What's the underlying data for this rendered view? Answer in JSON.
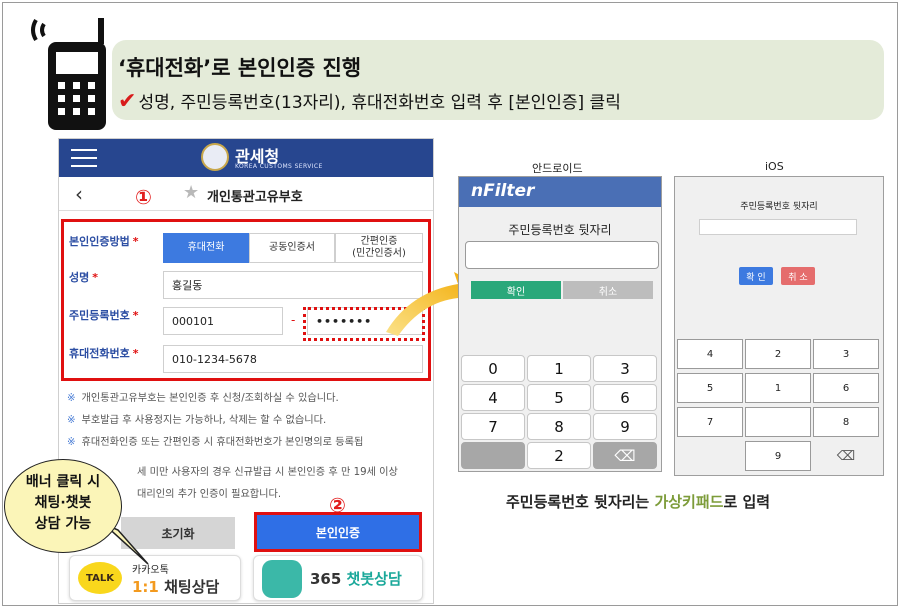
{
  "header": {
    "title": "‘휴대전화’로 본인인증 진행",
    "subtitle": "성명, 주민등록번호(13자리), 휴대전화번호 입력 후 [본인인증] 클릭",
    "check_mark": "✔"
  },
  "form_panel": {
    "org_name": "관세청",
    "org_subtitle": "KOREA CUSTOMS SERVICE",
    "page_title": "개인통관고유부호",
    "step1": "①",
    "step2": "②",
    "auth_method_label": "본인인증방법",
    "tabs": [
      "휴대전화",
      "공동인증서",
      "간편인증\n(민간인증서)"
    ],
    "name_label": "성명",
    "name_value": "홍길동",
    "rrn_label": "주민등록번호",
    "rrn_front": "000101",
    "rrn_dash": "-",
    "rrn_back": "•••••••",
    "phone_label": "휴대전화번호",
    "phone_value": "010-1234-5678",
    "required_mark": "*",
    "note_mark": "※",
    "notes": [
      "개인통관고유부호는 본인인증 후 신청/조회하실 수 있습니다.",
      "부호발급 후 사용정지는 가능하나, 삭제는 할 수 없습니다.",
      "휴대전화인증 또는 간편인증 시 휴대전화번호가 본인명의로 등록됩",
      "세 미만 사용자의 경우 신규발급 시 본인인증 후 만 19세 이상",
      "대리인의 추가 인증이 필요합니다."
    ],
    "reset_button": "초기화",
    "cert_button": "본인인증",
    "kakao_line1": "카카오톡",
    "kakao_line2_a": "1:1",
    "kakao_line2_b": " 채팅상담",
    "kakao_talk": "TALK",
    "bot_text_a": "365 ",
    "bot_text_b": "챗봇상담"
  },
  "callout": {
    "line1": "배너 클릭 시",
    "line2": "채팅·챗봇",
    "line3": "상담 가능"
  },
  "android": {
    "caption": "안드로이드",
    "logo": "nFilter",
    "label": "주민등록번호 뒷자리",
    "ok": "확인",
    "cancel": "취소",
    "keys": [
      "0",
      "1",
      "3",
      "4",
      "5",
      "6",
      "7",
      "8",
      "9",
      "",
      "2",
      "⌫"
    ]
  },
  "ios": {
    "caption": "iOS",
    "label": "주민등록번호 뒷자리",
    "ok": "확 인",
    "cancel": "취 소",
    "keys": [
      "4",
      "2",
      "3",
      "5",
      "1",
      "6",
      "7",
      "",
      "8",
      "",
      "9",
      "⌫"
    ]
  },
  "bottom_caption": {
    "a": "주민등록번호 뒷자리는 ",
    "b": "가상키패드",
    "c": "로 입력"
  },
  "colors": {
    "banner_bg": "#e4ebd9",
    "navy": "#27468f",
    "highlight_red": "#e01010",
    "primary_blue": "#2f6fe6",
    "android_green": "#2aa87a",
    "keypad_accent": "#7d9c3a"
  }
}
